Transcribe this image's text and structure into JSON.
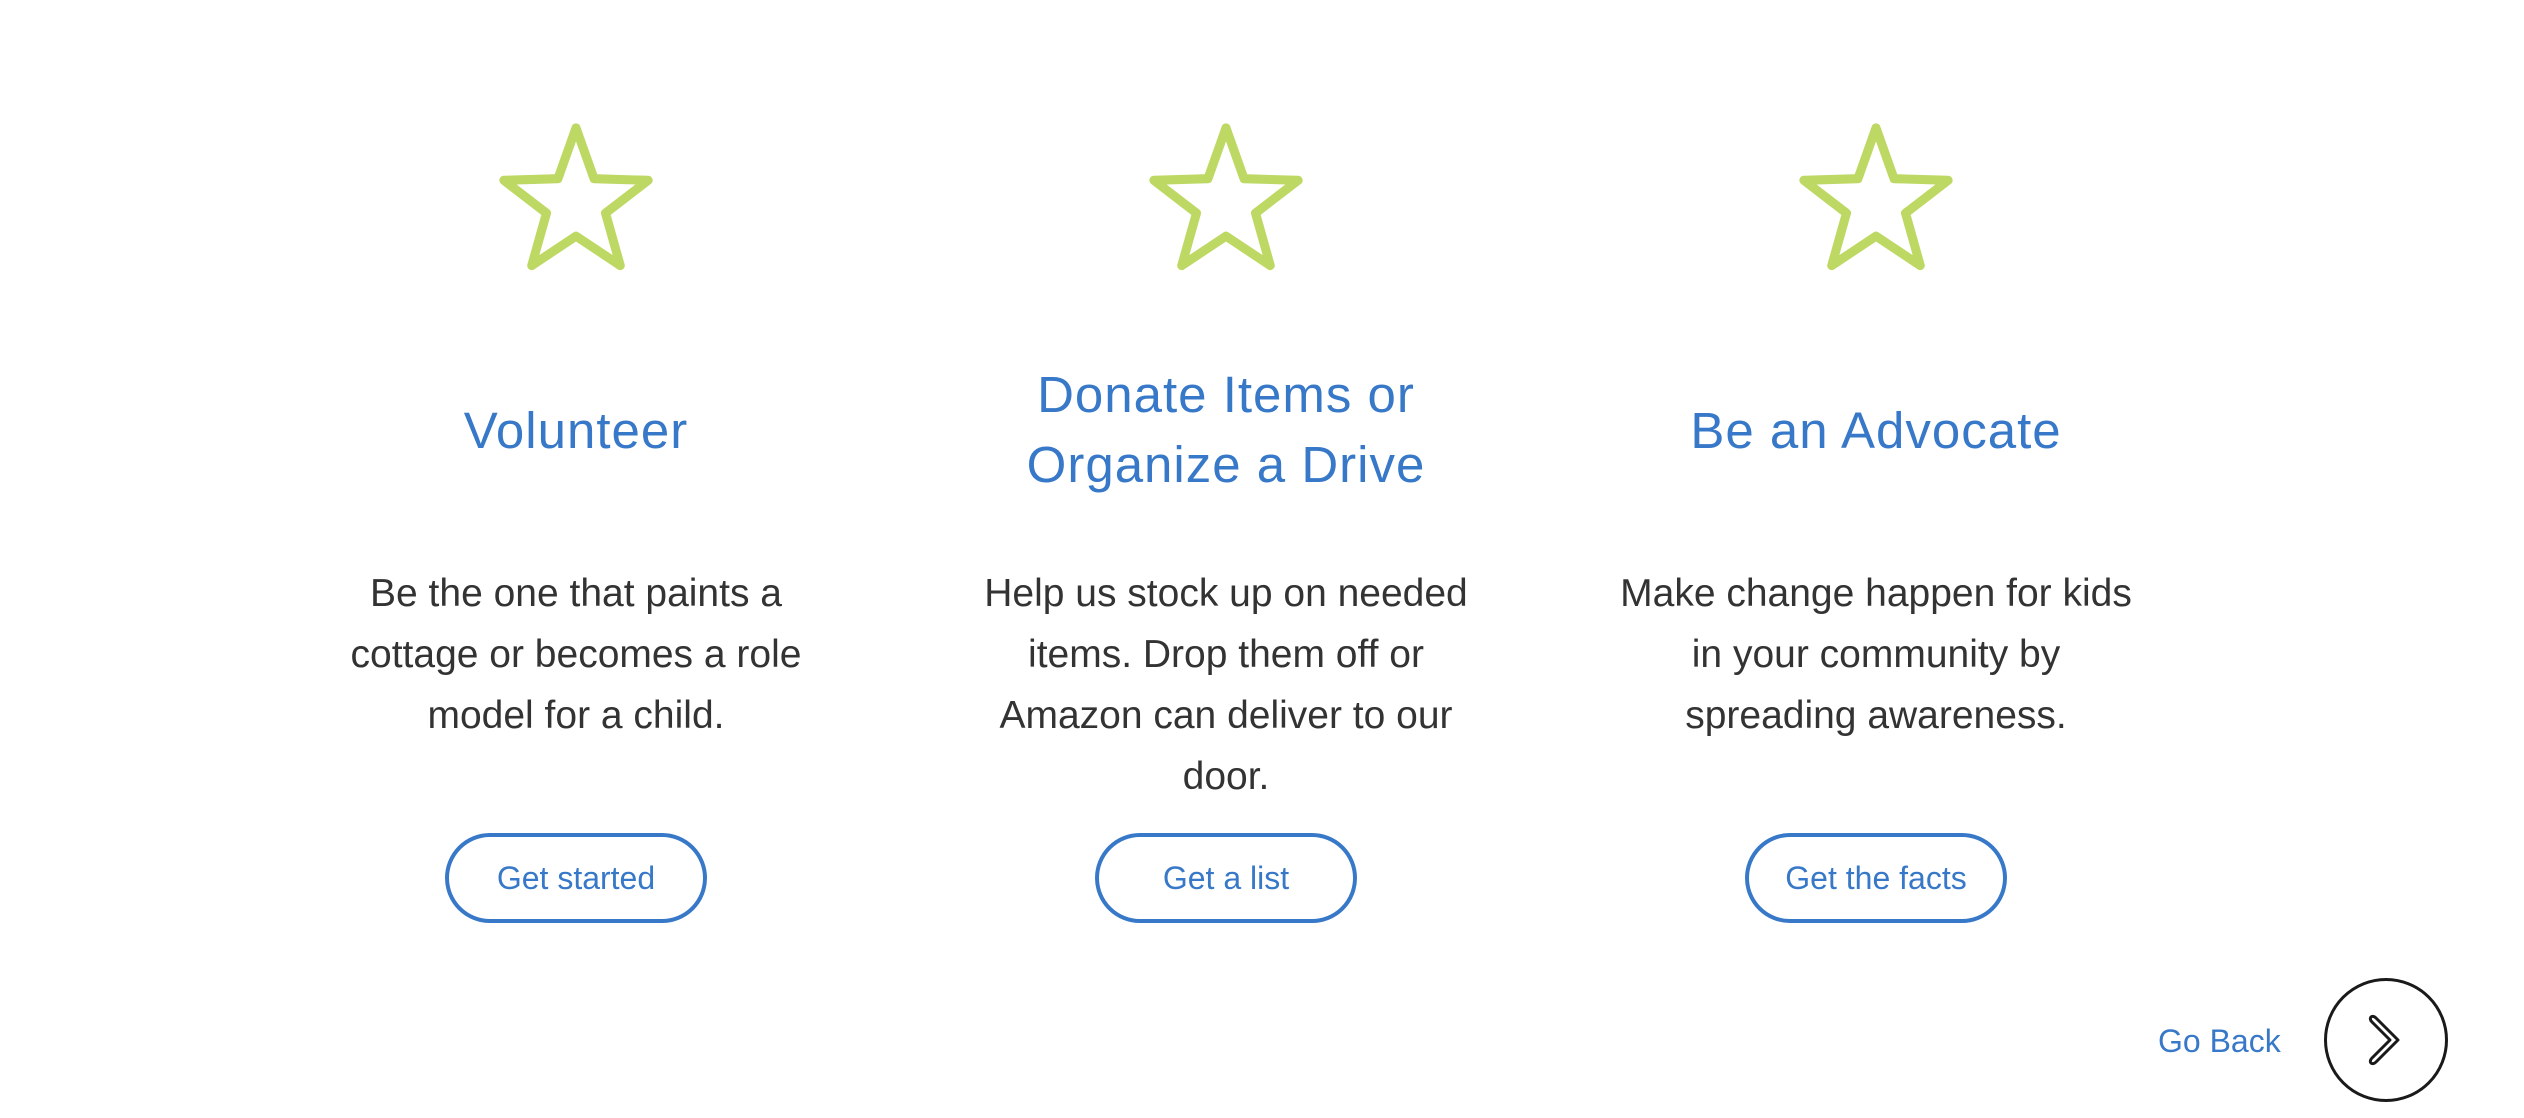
{
  "colors": {
    "accent": "#3778c8",
    "star": "#bed864",
    "text": "#333333",
    "circle_border": "#1a1a1a"
  },
  "cards": [
    {
      "icon": "star-outline-icon",
      "title_line1": "Volunteer",
      "title_line2": "",
      "description": "Be the one that paints a cottage or becomes a role model for a child.",
      "button_label": "Get started"
    },
    {
      "icon": "star-outline-icon",
      "title_line1": "Donate Items or",
      "title_line2": "Organize a Drive",
      "description": "Help us stock up on needed items. Drop them off or Amazon can deliver to our door.",
      "button_label": "Get a list"
    },
    {
      "icon": "star-outline-icon",
      "title_line1": "Be an Advocate",
      "title_line2": "",
      "description": "Make change happen for kids in your community by spreading awareness.",
      "button_label": "Get the facts"
    }
  ],
  "navigation": {
    "go_back_label": "Go Back",
    "next_icon": "chevron-right-icon"
  }
}
